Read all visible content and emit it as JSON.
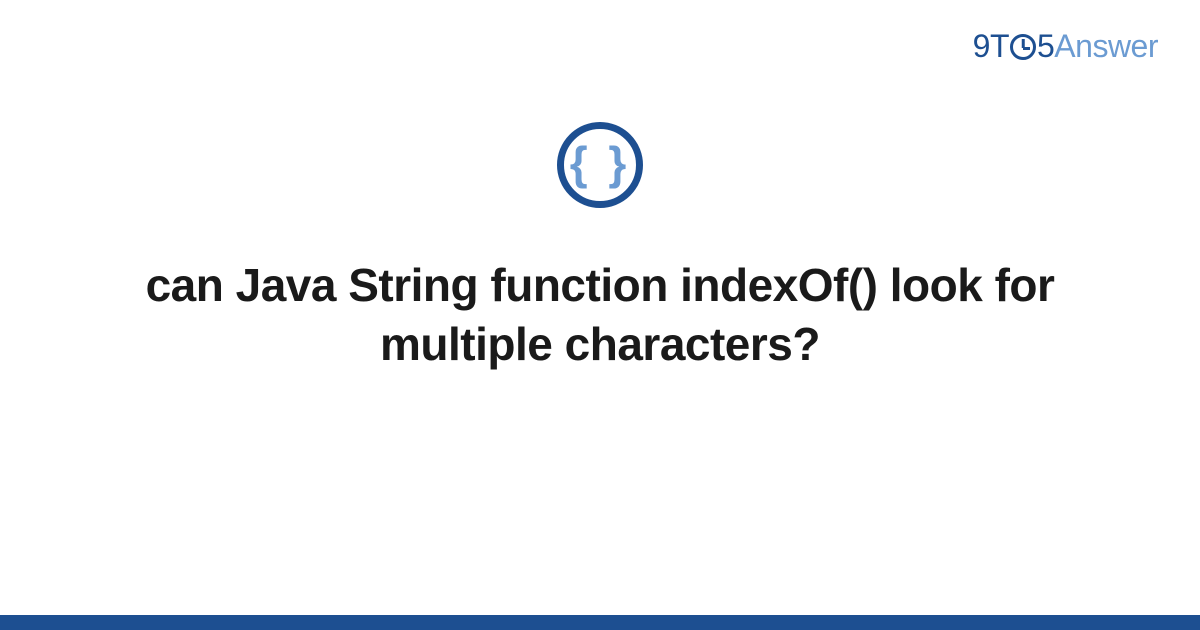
{
  "logo": {
    "part1": "9T",
    "part2": "5",
    "part3": "Answer"
  },
  "icon": {
    "braces": "{ }"
  },
  "title": "can Java String function indexOf() look for multiple characters?",
  "colors": {
    "primary": "#1d4f91",
    "secondary": "#6b9bd2"
  }
}
